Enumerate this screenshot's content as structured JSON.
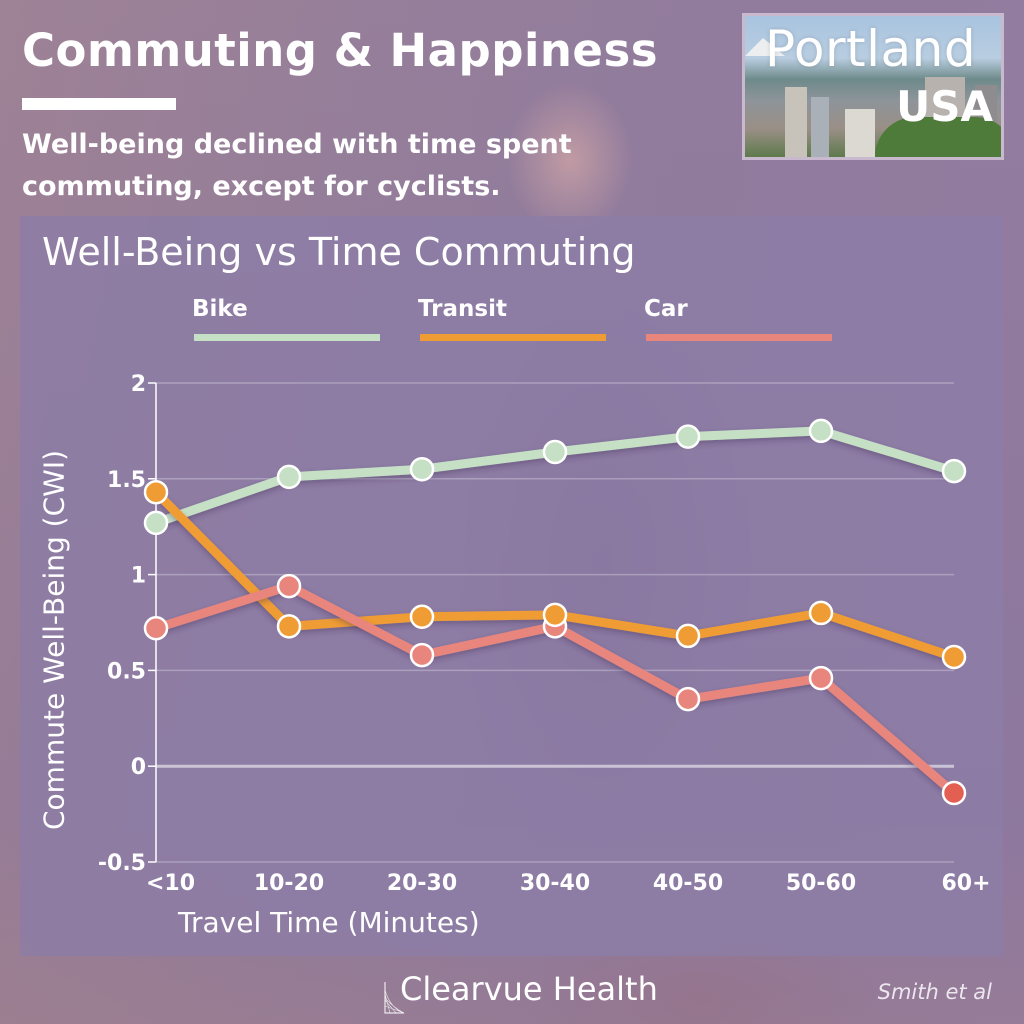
{
  "header": {
    "title": "Commuting & Happiness",
    "subtitle": "Well-being declined with time spent commuting, except for cyclists."
  },
  "badge": {
    "city": "Portland",
    "country": "USA"
  },
  "colors": {
    "bike": "#c6e0c6",
    "transit": "#ef9c34",
    "car": "#e8867e",
    "car_last": "#e35f52",
    "panel": "#8c7ca6"
  },
  "chart_data": {
    "type": "line",
    "title": "Well-Being vs Time Commuting",
    "xlabel": "Travel Time (Minutes)",
    "ylabel": "Commute Well-Being (CWI)",
    "categories": [
      "<10",
      "10-20",
      "20-30",
      "30-40",
      "40-50",
      "50-60",
      "60+"
    ],
    "ylim": [
      -0.5,
      2
    ],
    "yticks": [
      -0.5,
      0,
      0.5,
      1,
      1.5,
      2
    ],
    "ytick_labels": [
      "-0.5",
      "0",
      "0.5",
      "1",
      "1.5",
      "2"
    ],
    "grid": true,
    "legend_position": "top",
    "series": [
      {
        "name": "Bike",
        "color_key": "bike",
        "values": [
          1.27,
          1.51,
          1.55,
          1.64,
          1.72,
          1.75,
          1.54
        ]
      },
      {
        "name": "Transit",
        "color_key": "transit",
        "values": [
          1.43,
          0.73,
          0.78,
          0.79,
          0.68,
          0.8,
          0.57
        ]
      },
      {
        "name": "Car",
        "color_key": "car",
        "values": [
          0.72,
          0.94,
          0.58,
          0.73,
          0.35,
          0.46,
          -0.14
        ]
      }
    ]
  },
  "footer": {
    "brand": "Clearvue Health",
    "citation": "Smith et al"
  }
}
